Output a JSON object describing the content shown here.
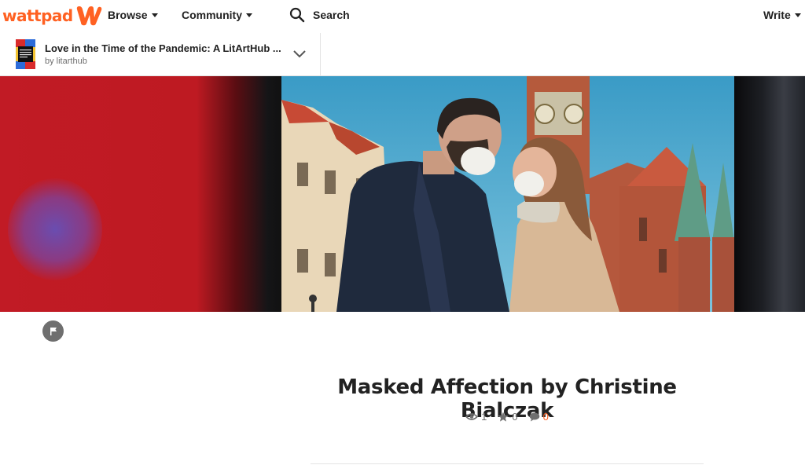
{
  "nav": {
    "logo_text": "wattpad",
    "browse_label": "Browse",
    "community_label": "Community",
    "search_label": "Search",
    "write_label": "Write"
  },
  "story": {
    "title": "Love in the Time of the Pandemic: A LitArtHub ...",
    "author": "by litarthub"
  },
  "part": {
    "title": "Masked Affection by Christine Bialczak",
    "views": "1",
    "votes": "0",
    "comments": "0"
  },
  "colors": {
    "brand": "#ff6122",
    "banner_red": "#c11b25",
    "text": "#222222",
    "muted": "#6f6f6f"
  },
  "icons": [
    "wattpad-logo-icon",
    "search-icon",
    "chevron-down-icon",
    "flag-icon",
    "eye-icon",
    "star-icon",
    "comment-icon"
  ]
}
